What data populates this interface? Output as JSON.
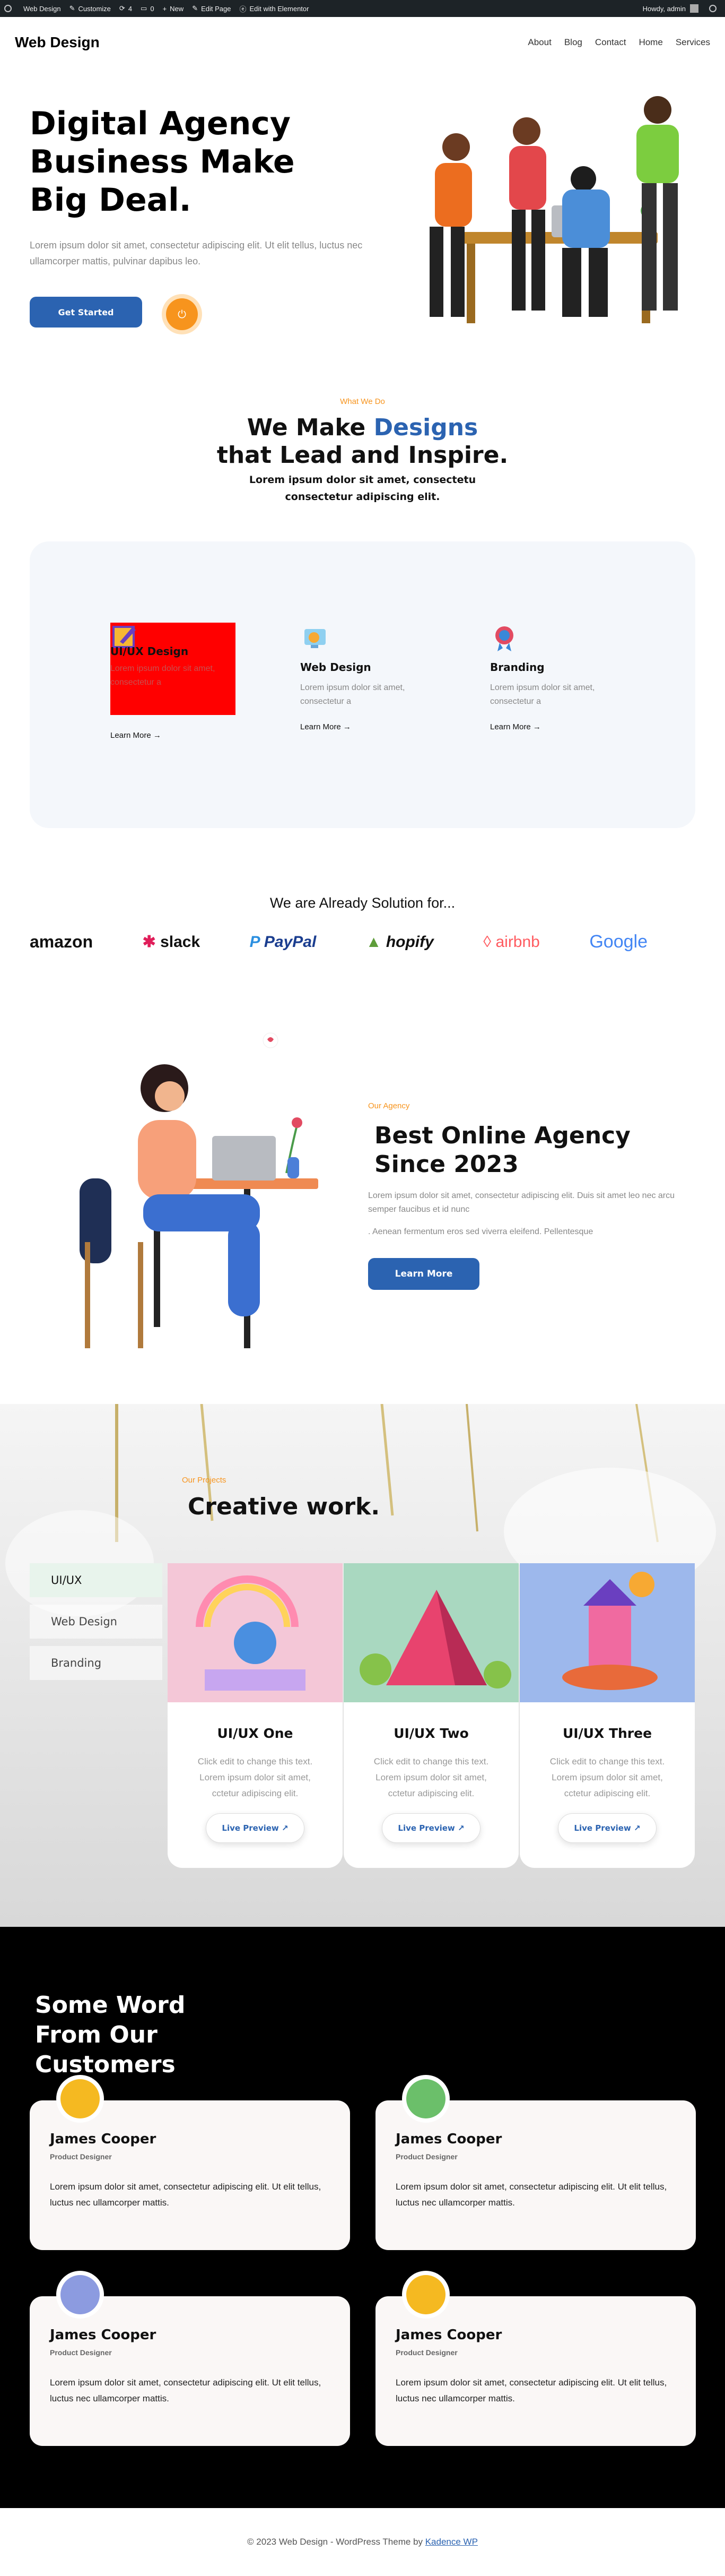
{
  "admin_bar": {
    "items": [
      "Web Design",
      "Customize",
      "4",
      "0",
      "New",
      "Edit Page",
      "Edit with Elementor"
    ],
    "greeting": "Howdy, admin"
  },
  "header": {
    "logo": "Web Design",
    "nav": [
      "About",
      "Blog",
      "Contact",
      "Home",
      "Services"
    ]
  },
  "hero": {
    "title": "Digital Agency Business Make Big Deal.",
    "text": "Lorem ipsum dolor sit amet, consectetur adipiscing elit. Ut elit tellus, luctus nec ullamcorper mattis, pulvinar dapibus leo.",
    "cta": "Get Started",
    "play_icon": "play-icon"
  },
  "what_we_do": {
    "eyebrow": "What We Do",
    "title_part1": "We Make ",
    "title_accent": "Designs",
    "title_part2": "that Lead and Inspire.",
    "subtitle": "Lorem ipsum dolor sit amet, consectetu consectetur adipiscing elit."
  },
  "services": [
    {
      "icon": "design-icon",
      "title": "UI/UX Design",
      "text": "Lorem ipsum dolor sit amet, consectetur a",
      "link": "Learn More →"
    },
    {
      "icon": "web-design-icon",
      "title": "Web Design",
      "text": "Lorem ipsum dolor sit amet, consectetur a",
      "link": "Learn More →"
    },
    {
      "icon": "branding-icon",
      "title": "Branding",
      "text": "Lorem ipsum dolor sit amet, consectetur a",
      "link": "Learn More →"
    }
  ],
  "brands": {
    "title": "We are Already Solution for...",
    "logos": [
      "amazon",
      "slack",
      "PayPal",
      "hopify",
      "airbnb",
      "Google"
    ]
  },
  "agency": {
    "eyebrow": "Our Agency",
    "title": "Best Online Agency Since 2023",
    "p1": "Lorem ipsum dolor sit amet, consectetur adipiscing elit. Duis sit amet leo nec arcu semper faucibus et id nunc",
    ".p2": "",
    "p2": ". Aenean fermentum eros sed viverra eleifend. Pellentesque",
    "cta": "Learn More"
  },
  "projects": {
    "eyebrow": "Our Projects",
    "title": "Creative work.",
    "tabs": [
      "UI/UX",
      "Web Design",
      "Branding"
    ],
    "cards": [
      {
        "title": "UI/UX One",
        "text": "Click edit to change this text. Lorem ipsum dolor sit amet, cctetur adipiscing elit.",
        "button": "Live Preview"
      },
      {
        "title": "UI/UX Two",
        "text": "Click edit to change this text. Lorem ipsum dolor sit amet, cctetur adipiscing elit.",
        "button": "Live Preview"
      },
      {
        "title": "UI/UX Three",
        "text": "Click edit to change this text. Lorem ipsum dolor sit amet, cctetur adipiscing elit.",
        "button": "Live Preview"
      }
    ]
  },
  "testimonials": {
    "title": "Some Word From Our Customers",
    "items": [
      {
        "name": "James Cooper",
        "role": "Product Designer",
        "text": "Lorem ipsum dolor sit amet, consectetur adipiscing elit. Ut elit tellus, luctus nec ullamcorper mattis.",
        "avatar_color": "#f5b921"
      },
      {
        "name": "James Cooper",
        "role": "Product Designer",
        "text": "Lorem ipsum dolor sit amet, consectetur adipiscing elit. Ut elit tellus, luctus nec ullamcorper mattis.",
        "avatar_color": "#6bbf6a"
      },
      {
        "name": "James Cooper",
        "role": "Product Designer",
        "text": "Lorem ipsum dolor sit amet, consectetur adipiscing elit. Ut elit tellus, luctus nec ullamcorper mattis.",
        "avatar_color": "#8c9be0"
      },
      {
        "name": "James Cooper",
        "role": "Product Designer",
        "text": "Lorem ipsum dolor sit amet, consectetur adipiscing elit. Ut elit tellus, luctus nec ullamcorper mattis.",
        "avatar_color": "#f5b921"
      }
    ]
  },
  "footer": {
    "text": "© 2023 Web Design - WordPress Theme by ",
    "link": "Kadence WP"
  },
  "colors": {
    "accent": "#2b63b1",
    "orange": "#f7941d"
  }
}
